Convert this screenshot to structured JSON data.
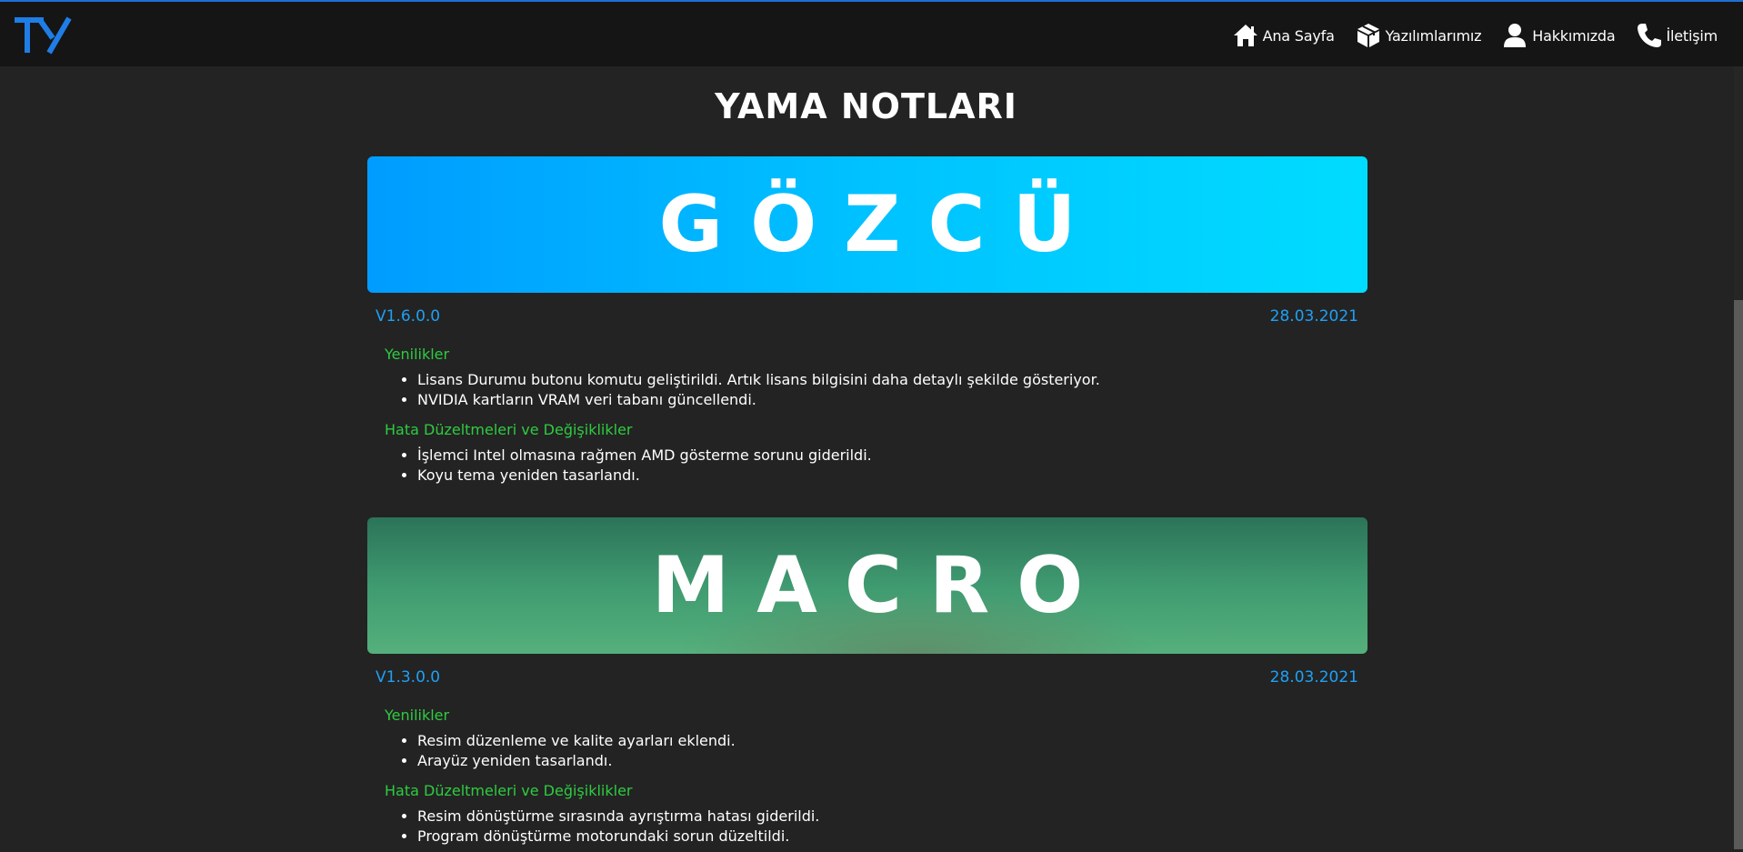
{
  "brand": {
    "logo_text": "TY",
    "accent": "#1f6fd6"
  },
  "nav": {
    "items": [
      {
        "label": "Ana Sayfa",
        "icon": "home-icon"
      },
      {
        "label": "Yazılımlarımız",
        "icon": "box-icon"
      },
      {
        "label": "Hakkımızda",
        "icon": "user-icon"
      },
      {
        "label": "İletişim",
        "icon": "phone-icon"
      }
    ]
  },
  "page": {
    "title": "YAMA NOTLARI"
  },
  "releases": [
    {
      "name": "GÖZCÜ",
      "version": "V1.6.0.0",
      "date": "28.03.2021",
      "sections": [
        {
          "title": "Yenilikler",
          "items": [
            "Lisans Durumu butonu komutu geliştirildi. Artık lisans bilgisini daha detaylı şekilde gösteriyor.",
            "NVIDIA kartların VRAM veri tabanı güncellendi."
          ]
        },
        {
          "title": "Hata Düzeltmeleri ve Değişiklikler",
          "items": [
            "İşlemci Intel olmasına rağmen AMD gösterme sorunu giderildi.",
            "Koyu tema yeniden tasarlandı."
          ]
        }
      ]
    },
    {
      "name": "MACRO",
      "version": "V1.3.0.0",
      "date": "28.03.2021",
      "sections": [
        {
          "title": "Yenilikler",
          "items": [
            "Resim düzenleme ve kalite ayarları eklendi.",
            "Arayüz yeniden tasarlandı."
          ]
        },
        {
          "title": "Hata Düzeltmeleri ve Değişiklikler",
          "items": [
            "Resim dönüştürme sırasında ayrıştırma hatası giderildi.",
            "Program dönüştürme motorundaki sorun düzeltildi."
          ]
        }
      ]
    }
  ]
}
